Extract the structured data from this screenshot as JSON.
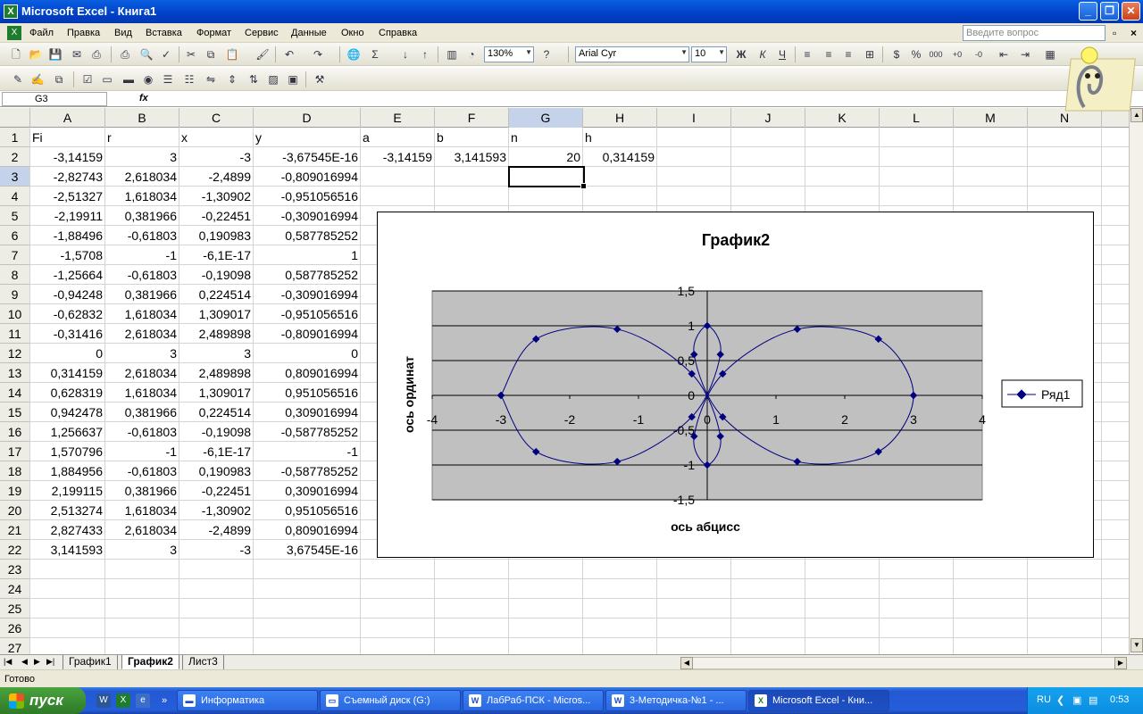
{
  "window": {
    "title": "Microsoft Excel - Книга1",
    "min": "_",
    "max": "❐",
    "close": "✕"
  },
  "menu": {
    "items": [
      "Файл",
      "Правка",
      "Вид",
      "Вставка",
      "Формат",
      "Сервис",
      "Данные",
      "Окно",
      "Справка"
    ],
    "help_placeholder": "Введите вопрос"
  },
  "toolbar": {
    "zoom": "130%",
    "font": "Arial Cyr",
    "size": "10"
  },
  "formula": {
    "namebox": "G3",
    "fx": "fx",
    "value": ""
  },
  "columns": [
    "A",
    "B",
    "C",
    "D",
    "E",
    "F",
    "G",
    "H",
    "I",
    "J",
    "K",
    "L",
    "M",
    "N"
  ],
  "rows": [
    "1",
    "2",
    "3",
    "4",
    "5",
    "6",
    "7",
    "8",
    "9",
    "10",
    "11",
    "12",
    "13",
    "14",
    "15",
    "16",
    "17",
    "18",
    "19",
    "20",
    "21",
    "22",
    "23",
    "24",
    "25",
    "26",
    "27"
  ],
  "header_row": [
    "Fi",
    "r",
    "x",
    "y",
    "a",
    "b",
    "n",
    "h"
  ],
  "params": [
    "-3,14159",
    "3,141593",
    "20",
    "0,314159"
  ],
  "table": [
    [
      "-3,14159",
      "3",
      "-3",
      "-3,67545E-16"
    ],
    [
      "-2,82743",
      "2,618034",
      "-2,4899",
      "-0,809016994"
    ],
    [
      "-2,51327",
      "1,618034",
      "-1,30902",
      "-0,951056516"
    ],
    [
      "-2,19911",
      "0,381966",
      "-0,22451",
      "-0,309016994"
    ],
    [
      "-1,88496",
      "-0,61803",
      "0,190983",
      "0,587785252"
    ],
    [
      "-1,5708",
      "-1",
      "-6,1E-17",
      "1"
    ],
    [
      "-1,25664",
      "-0,61803",
      "-0,19098",
      "0,587785252"
    ],
    [
      "-0,94248",
      "0,381966",
      "0,224514",
      "-0,309016994"
    ],
    [
      "-0,62832",
      "1,618034",
      "1,309017",
      "-0,951056516"
    ],
    [
      "-0,31416",
      "2,618034",
      "2,489898",
      "-0,809016994"
    ],
    [
      "0",
      "3",
      "3",
      "0"
    ],
    [
      "0,314159",
      "2,618034",
      "2,489898",
      "0,809016994"
    ],
    [
      "0,628319",
      "1,618034",
      "1,309017",
      "0,951056516"
    ],
    [
      "0,942478",
      "0,381966",
      "0,224514",
      "0,309016994"
    ],
    [
      "1,256637",
      "-0,61803",
      "-0,19098",
      "-0,587785252"
    ],
    [
      "1,570796",
      "-1",
      "-6,1E-17",
      "-1"
    ],
    [
      "1,884956",
      "-0,61803",
      "0,190983",
      "-0,587785252"
    ],
    [
      "2,199115",
      "0,381966",
      "-0,22451",
      "0,309016994"
    ],
    [
      "2,513274",
      "1,618034",
      "-1,30902",
      "0,951056516"
    ],
    [
      "2,827433",
      "2,618034",
      "-2,4899",
      "0,809016994"
    ],
    [
      "3,141593",
      "3",
      "-3",
      "3,67545E-16"
    ]
  ],
  "chart_data": {
    "type": "scatter",
    "title": "График2",
    "xlabel": "ось абцисс",
    "ylabel": "ось ординат",
    "xlim": [
      -4,
      4
    ],
    "ylim": [
      -1.5,
      1.5
    ],
    "xticks": [
      -4,
      -3,
      -2,
      -1,
      0,
      1,
      2,
      3,
      4
    ],
    "yticks": [
      -1.5,
      -1,
      -0.5,
      0,
      0.5,
      1,
      1.5
    ],
    "xtick_labels": [
      "-4",
      "-3",
      "-2",
      "-1",
      "0",
      "1",
      "2",
      "3",
      "4"
    ],
    "ytick_labels": [
      "-1,5",
      "-1",
      "-0,5",
      "0",
      "0,5",
      "1",
      "1,5"
    ],
    "grid": true,
    "legend": "right",
    "series": [
      {
        "name": "Ряд1",
        "color": "#000080",
        "x": [
          -3,
          -2.4899,
          -1.30902,
          -0.22451,
          0.190983,
          0,
          -0.19098,
          0.224514,
          1.309017,
          2.489898,
          3,
          2.489898,
          1.309017,
          0.224514,
          -0.19098,
          0,
          0.190983,
          -0.22451,
          -1.30902,
          -2.4899,
          -3
        ],
        "y": [
          0,
          -0.809017,
          -0.951057,
          -0.309017,
          0.587785,
          1,
          0.587785,
          -0.309017,
          -0.951057,
          -0.809017,
          0,
          0.809017,
          0.951057,
          0.309017,
          -0.587785,
          -1,
          -0.587785,
          0.309017,
          0.951057,
          0.809017,
          0
        ]
      }
    ]
  },
  "sheets": [
    "График1",
    "График2",
    "Лист3"
  ],
  "status": "Готово",
  "taskbar": {
    "start": "пуск",
    "items": [
      "Информатика",
      "Съемный диск (G:)",
      "ЛабРаб-ПСК - Micros...",
      "3-Методичка-№1 - ...",
      "Microsoft Excel - Кни..."
    ],
    "lang": "RU",
    "clock": "0:53"
  }
}
